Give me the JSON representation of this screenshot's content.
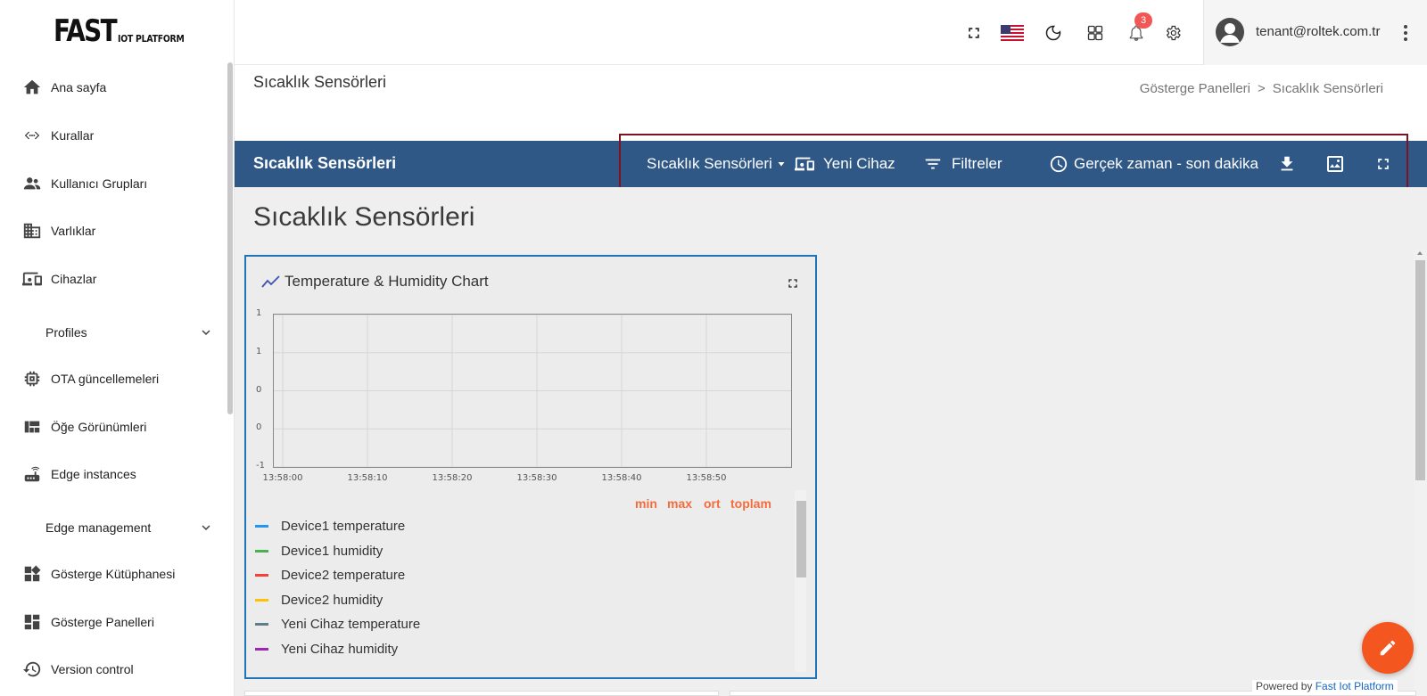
{
  "brand": {
    "logo_big": "FAST",
    "logo_small": "IOT PLATFORM"
  },
  "sidebar": {
    "items": [
      {
        "label": "Ana sayfa",
        "icon": "home-icon"
      },
      {
        "label": "Kurallar",
        "icon": "rule-chain-icon"
      },
      {
        "label": "Kullanıcı Grupları",
        "icon": "users-icon"
      },
      {
        "label": "Varlıklar",
        "icon": "domain-icon"
      },
      {
        "label": "Cihazlar",
        "icon": "devices-icon"
      },
      {
        "label": "Profiles",
        "icon": "chevron-down-icon"
      },
      {
        "label": "OTA güncellemeleri",
        "icon": "memory-chip-icon"
      },
      {
        "label": "Öğe Görünümleri",
        "icon": "view-quilt-icon"
      },
      {
        "label": "Edge instances",
        "icon": "router-icon"
      },
      {
        "label": "Edge management",
        "icon": "chevron-down-icon"
      },
      {
        "label": "Gösterge Kütüphanesi",
        "icon": "widgets-icon"
      },
      {
        "label": "Gösterge Panelleri",
        "icon": "dashboard-icon"
      },
      {
        "label": "Version control",
        "icon": "history-icon"
      }
    ]
  },
  "header": {
    "notifications_count": "3",
    "user_email": "tenant@roltek.com.tr"
  },
  "page": {
    "title": "Sıcaklık Sensörleri",
    "breadcrumb": [
      "Gösterge Panelleri",
      ">",
      "Sıcaklık Sensörleri"
    ]
  },
  "dashboard": {
    "toolbar_title": "Sıcaklık Sensörleri",
    "state_select": "Sıcaklık Sensörleri",
    "new_device": "Yeni Cihaz",
    "filters": "Filtreler",
    "timewindow": "Gerçek zaman - son dakika",
    "heading": "Sıcaklık Sensörleri"
  },
  "widget": {
    "title": "Temperature & Humidity Chart",
    "legend_headers": [
      "min",
      "max",
      "ort",
      "toplam"
    ],
    "legend": [
      {
        "name": "Device1 temperature",
        "color": "#2196f3"
      },
      {
        "name": "Device1 humidity",
        "color": "#4caf50"
      },
      {
        "name": "Device2 temperature",
        "color": "#f44336"
      },
      {
        "name": "Device2 humidity",
        "color": "#ffc107"
      },
      {
        "name": "Yeni Cihaz temperature",
        "color": "#607d8b"
      },
      {
        "name": "Yeni Cihaz humidity",
        "color": "#9c27b0"
      }
    ]
  },
  "chart_data": {
    "type": "line",
    "title": "Temperature & Humidity Chart",
    "xlabel": "",
    "ylabel": "",
    "x_ticks": [
      "13:58:00",
      "13:58:10",
      "13:58:20",
      "13:58:30",
      "13:58:40",
      "13:58:50"
    ],
    "y_ticks": [
      "1",
      "1",
      "0",
      "0",
      "-1"
    ],
    "ylim": [
      -1,
      1
    ],
    "grid": true,
    "series": [
      {
        "name": "Device1 temperature",
        "values": []
      },
      {
        "name": "Device1 humidity",
        "values": []
      },
      {
        "name": "Device2 temperature",
        "values": []
      },
      {
        "name": "Device2 humidity",
        "values": []
      },
      {
        "name": "Yeni Cihaz temperature",
        "values": []
      },
      {
        "name": "Yeni Cihaz humidity",
        "values": []
      }
    ]
  },
  "footer": {
    "powered_prefix": "Powered by",
    "powered_brand": "Fast Iot Platform"
  }
}
